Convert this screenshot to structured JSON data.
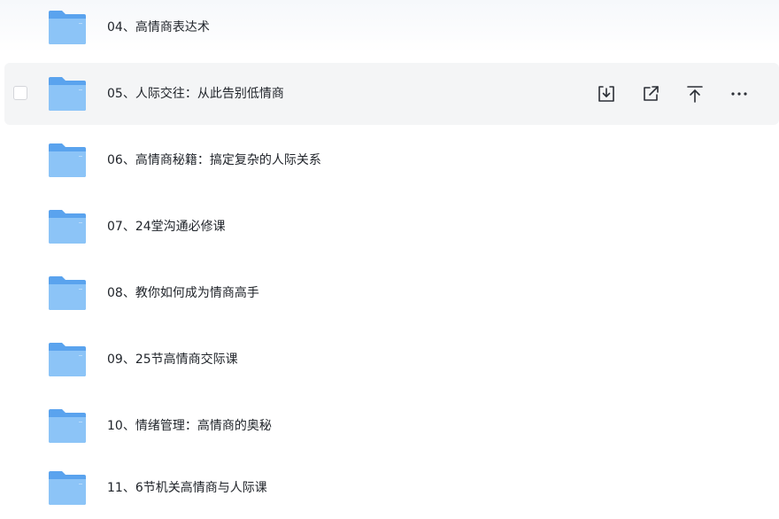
{
  "files": [
    {
      "name": "04、高情商表达术",
      "type": "folder",
      "hovered": false
    },
    {
      "name": "05、人际交往：从此告别低情商",
      "type": "folder",
      "hovered": true
    },
    {
      "name": "06、高情商秘籍：搞定复杂的人际关系",
      "type": "folder",
      "hovered": false
    },
    {
      "name": "07、24堂沟通必修课",
      "type": "folder",
      "hovered": false
    },
    {
      "name": "08、教你如何成为情商高手",
      "type": "folder",
      "hovered": false
    },
    {
      "name": "09、25节高情商交际课",
      "type": "folder",
      "hovered": false
    },
    {
      "name": "10、情绪管理：高情商的奥秘",
      "type": "folder",
      "hovered": false
    },
    {
      "name": "11、6节机关高情商与人际课",
      "type": "folder",
      "hovered": false
    }
  ],
  "row_actions": [
    {
      "icon": "download-icon"
    },
    {
      "icon": "share-icon"
    },
    {
      "icon": "move-to-top-icon"
    },
    {
      "icon": "more-icon"
    }
  ],
  "colors": {
    "folder_back": "#5aa3ee",
    "folder_front": "#8cc4f7",
    "hover_bg": "#f4f5f6",
    "text": "#1f2329"
  }
}
